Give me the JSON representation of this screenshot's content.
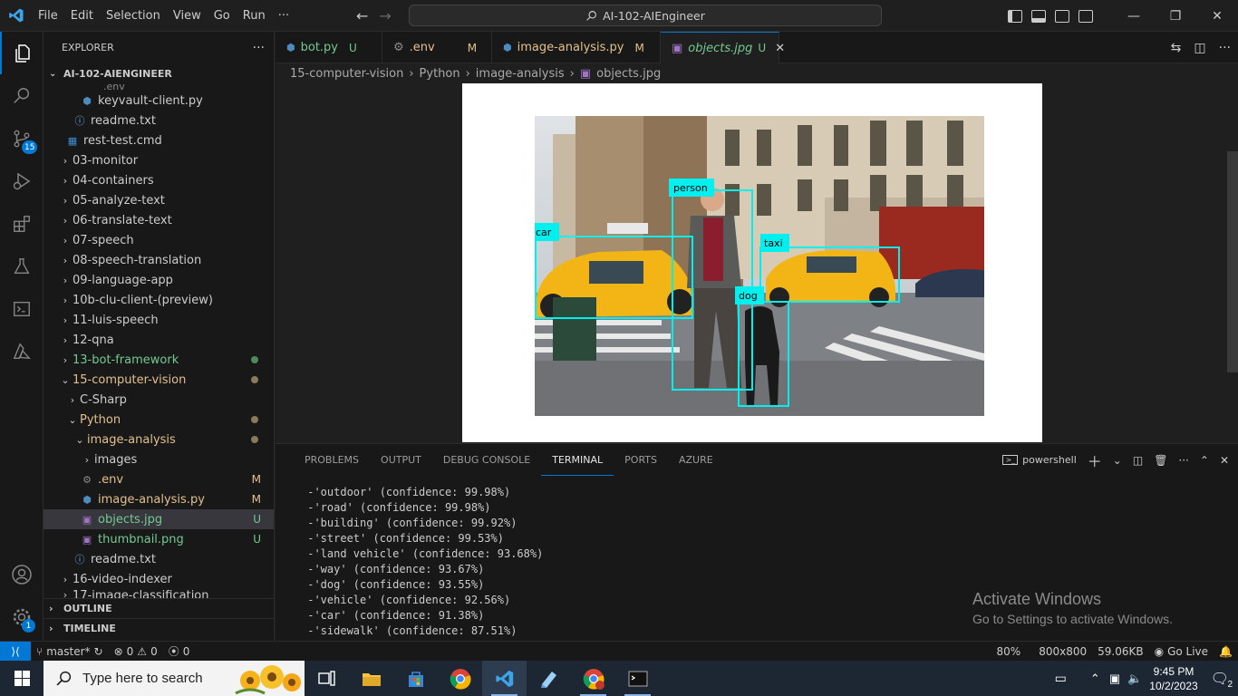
{
  "titlebar": {
    "menu": [
      "File",
      "Edit",
      "Selection",
      "View",
      "Go",
      "Run",
      "···"
    ],
    "search_text": "AI-102-AIEngineer"
  },
  "activity": {
    "scm_badge": "15",
    "accounts_badge": "1"
  },
  "explorer": {
    "header": "EXPLORER",
    "more": "···",
    "root": "AI-102-AIENGINEER",
    "clipped_top": ".env",
    "items": [
      {
        "label": "keyvault-client.py",
        "status": ""
      },
      {
        "label": "readme.txt",
        "status": ""
      },
      {
        "label": "rest-test.cmd",
        "status": ""
      },
      {
        "label": "03-monitor",
        "status": ""
      },
      {
        "label": "04-containers",
        "status": ""
      },
      {
        "label": "05-analyze-text",
        "status": ""
      },
      {
        "label": "06-translate-text",
        "status": ""
      },
      {
        "label": "07-speech",
        "status": ""
      },
      {
        "label": "08-speech-translation",
        "status": ""
      },
      {
        "label": "09-language-app",
        "status": ""
      },
      {
        "label": "10b-clu-client-(preview)",
        "status": ""
      },
      {
        "label": "11-luis-speech",
        "status": ""
      },
      {
        "label": "12-qna",
        "status": ""
      },
      {
        "label": "13-bot-framework",
        "status": ""
      },
      {
        "label": "15-computer-vision",
        "status": ""
      },
      {
        "label": "C-Sharp",
        "status": ""
      },
      {
        "label": "Python",
        "status": ""
      },
      {
        "label": "image-analysis",
        "status": ""
      },
      {
        "label": "images",
        "status": ""
      },
      {
        "label": ".env",
        "status": "M"
      },
      {
        "label": "image-analysis.py",
        "status": "M"
      },
      {
        "label": "objects.jpg",
        "status": "U"
      },
      {
        "label": "thumbnail.png",
        "status": "U"
      },
      {
        "label": "readme.txt",
        "status": ""
      },
      {
        "label": "16-video-indexer",
        "status": ""
      },
      {
        "label": "17-image-classification",
        "status": ""
      }
    ],
    "outline": "OUTLINE",
    "timeline": "TIMELINE"
  },
  "tabs": [
    {
      "label": "bot.py",
      "status": "U"
    },
    {
      "label": ".env",
      "status": "M"
    },
    {
      "label": "image-analysis.py",
      "status": "M"
    },
    {
      "label": "objects.jpg",
      "status": "U"
    }
  ],
  "breadcrumb": [
    "15-computer-vision",
    "Python",
    "image-analysis",
    "objects.jpg"
  ],
  "detections": [
    "person",
    "car",
    "taxi",
    "dog"
  ],
  "panel": {
    "tabs": [
      "PROBLEMS",
      "OUTPUT",
      "DEBUG CONSOLE",
      "TERMINAL",
      "PORTS",
      "AZURE"
    ],
    "shell": "powershell",
    "terminal_lines": [
      " -'outdoor' (confidence: 99.98%)",
      " -'road' (confidence: 99.98%)",
      " -'building' (confidence: 99.92%)",
      " -'street' (confidence: 99.53%)",
      " -'land vehicle' (confidence: 93.68%)",
      " -'way' (confidence: 93.67%)",
      " -'dog' (confidence: 93.55%)",
      " -'vehicle' (confidence: 92.56%)",
      " -'car' (confidence: 91.38%)",
      " -'sidewalk' (confidence: 87.51%)"
    ],
    "watermark_title": "Activate Windows",
    "watermark_sub": "Go to Settings to activate Windows."
  },
  "status": {
    "branch": "master*",
    "errors": "0",
    "warnings": "0",
    "ports": "0",
    "zoom": "80%",
    "dims": "800x800",
    "size": "59.06KB",
    "golive": "Go Live"
  },
  "taskbar": {
    "search_placeholder": "Type here to search",
    "time": "9:45 PM",
    "date": "10/2/2023",
    "notif": "2"
  }
}
